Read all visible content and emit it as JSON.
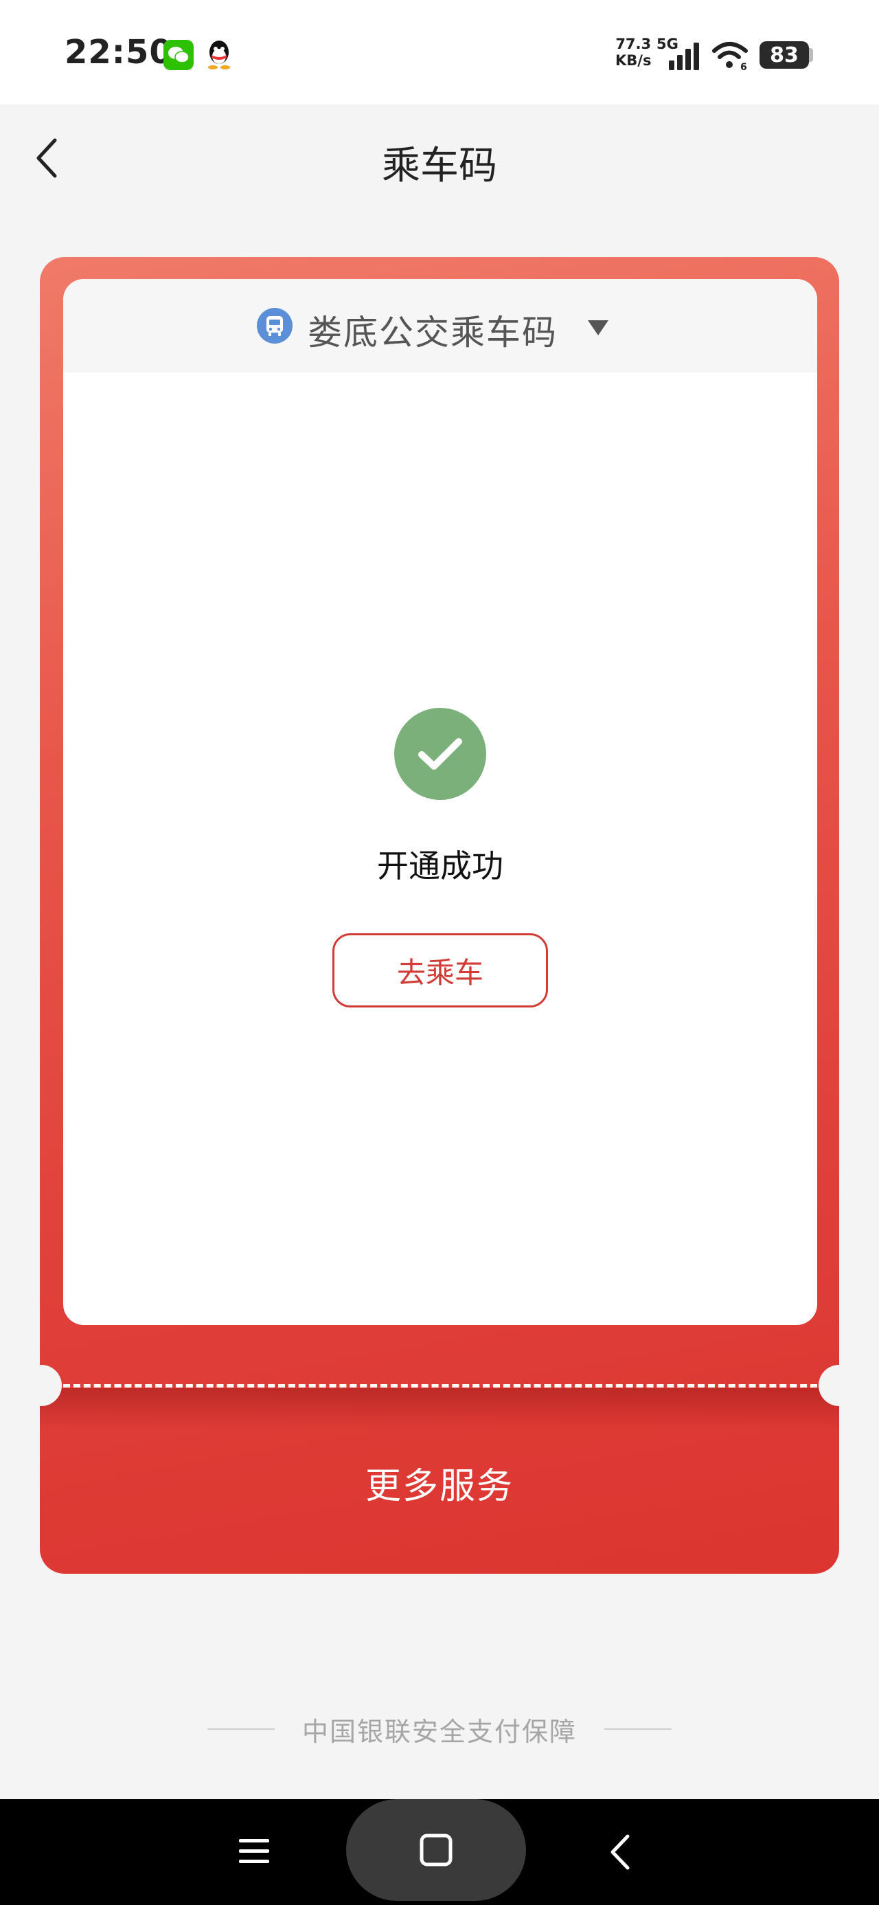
{
  "status_bar": {
    "time": "22:50",
    "net_speed_value": "77.3",
    "net_speed_unit": "KB/s",
    "net_type": "5G",
    "battery": "83",
    "icons": [
      "wechat-icon",
      "qq-icon",
      "signal-icon",
      "wifi-icon",
      "battery-icon"
    ]
  },
  "header": {
    "title": "乘车码",
    "back_icon": "chevron-left-icon"
  },
  "card": {
    "selector": {
      "label": "娄底公交乘车码",
      "icon": "bus-icon",
      "dropdown_icon": "triangle-down-icon"
    },
    "status": {
      "icon": "check-circle-icon",
      "text": "开通成功"
    },
    "ride_button_label": "去乘车",
    "more_services_label": "更多服务"
  },
  "footer": {
    "text": "中国银联安全支付保障"
  },
  "colors": {
    "card_red": "#e0403a",
    "success_green": "#7cb07a",
    "accent_red": "#d23b36",
    "bus_icon_blue": "#5b8fd8"
  }
}
